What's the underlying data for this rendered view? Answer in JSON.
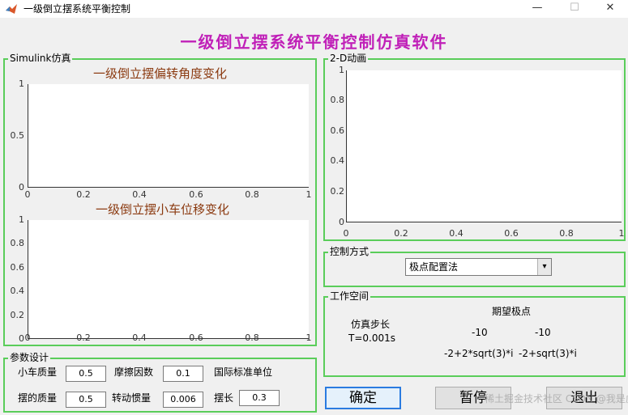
{
  "window": {
    "title": "一级倒立摆系统平衡控制",
    "min_glyph": "—",
    "max_glyph": "☐",
    "close_glyph": "✕"
  },
  "main_title": "一级倒立摆系统平衡控制仿真软件",
  "simulink_panel": {
    "title": "Simulink仿真",
    "plot1": {
      "title": "一级倒立摆偏转角度变化",
      "yticks": [
        "1",
        "0.5",
        "0"
      ],
      "xticks": [
        "0",
        "0.2",
        "0.4",
        "0.6",
        "0.8",
        "1"
      ]
    },
    "plot2": {
      "title": "一级倒立摆小车位移变化",
      "yticks": [
        "1",
        "0.8",
        "0.6",
        "0.4",
        "0.2",
        "0"
      ],
      "xticks": [
        "0",
        "0.2",
        "0.4",
        "0.6",
        "0.8",
        "1"
      ]
    }
  },
  "animation_panel": {
    "title": "2-D动画",
    "yticks": [
      "1",
      "0.8",
      "0.6",
      "0.4",
      "0.2",
      "0"
    ],
    "xticks": [
      "0",
      "0.2",
      "0.4",
      "0.6",
      "0.8",
      "1"
    ]
  },
  "params_panel": {
    "title": "参数设计",
    "cart_mass_label": "小车质量",
    "cart_mass": "0.5",
    "friction_label": "摩擦因数",
    "friction": "0.1",
    "si_units": "国际标准单位",
    "pendulum_mass_label": "摆的质量",
    "pendulum_mass": "0.5",
    "inertia_label": "转动惯量",
    "inertia": "0.006",
    "length_label": "摆长",
    "length": "0.3"
  },
  "control_panel": {
    "title": "控制方式",
    "selected": "极点配置法"
  },
  "workspace_panel": {
    "title": "工作空间",
    "step_label": "仿真步长",
    "step_value": "T=0.001s",
    "poles_label": "期望极点",
    "pole1": "-10",
    "pole2": "-10",
    "pole3": "-2+2*sqrt(3)*i",
    "pole4": "-2+sqrt(3)*i"
  },
  "buttons": {
    "ok": "确定",
    "pause": "暂停",
    "exit": "退出"
  },
  "watermark": "稀土掘金技术社区 CSDN @我是虎啸"
}
